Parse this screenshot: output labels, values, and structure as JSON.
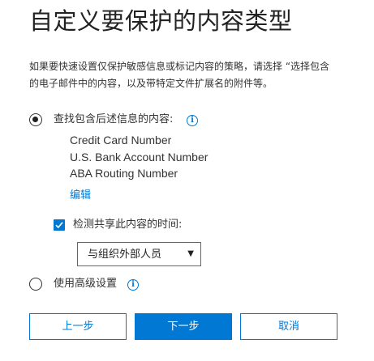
{
  "page": {
    "title": "自定义要保护的内容类型",
    "description_line1": "如果要快速设置仅保护敏感信息或标记内容的策略，请选择 “选择包含",
    "description_line2": "的电子邮件中的内容，以及带特定文件扩展名的附件等。"
  },
  "options": {
    "find_content": {
      "label": "查找包含后述信息的内容:",
      "selected": true,
      "info_icon": "i",
      "info_types": [
        "Credit Card Number",
        "U.S. Bank Account Number",
        "ABA Routing Number"
      ],
      "edit_label": "编辑",
      "detect_sharing": {
        "label": "检测共享此内容的时间:",
        "checked": true,
        "dropdown_value": "与组织外部人员",
        "dropdown_arrow": "▼"
      }
    },
    "advanced": {
      "label": "使用高级设置",
      "selected": false,
      "info_icon": "i"
    }
  },
  "buttons": {
    "back_label": "上一步",
    "next_label": "下一步",
    "cancel_label": "取消"
  },
  "colors": {
    "accent": "#0078d4",
    "text": "#333333"
  }
}
